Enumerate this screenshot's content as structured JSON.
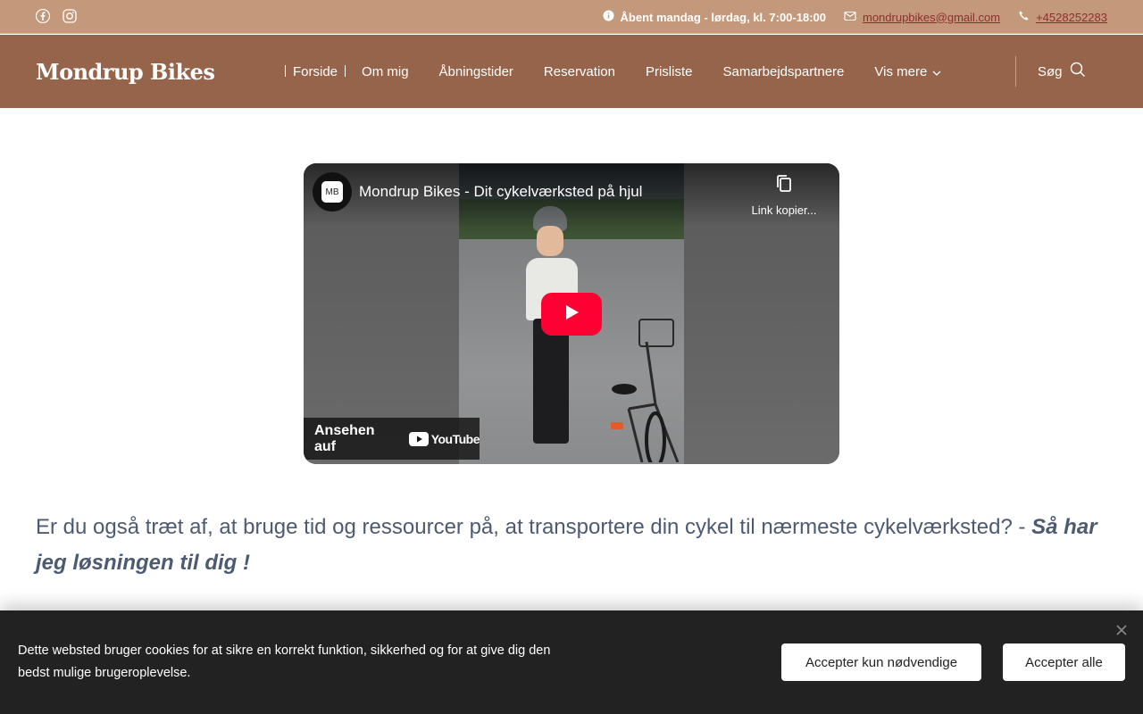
{
  "topbar": {
    "social": [
      "facebook-icon",
      "instagram-icon"
    ],
    "hours": "Åbent mandag - lørdag, kl. 7:00-18:00",
    "email": "mondrupbikes@gmail.com",
    "phone": "+4528252283"
  },
  "header": {
    "logo": "Mondrup Bikes",
    "nav": [
      "Forside",
      "Om mig",
      "Åbningstider",
      "Reservation",
      "Prisliste",
      "Samarbejdspartnere"
    ],
    "more_label": "Vis mere",
    "search_label": "Søg"
  },
  "video": {
    "channel_badge": "MB",
    "title": "Mondrup Bikes - Dit cykelværksted på hjul",
    "copy_label": "Link kopier...",
    "watch_label": "Ansehen auf",
    "youtube_label": "YouTube"
  },
  "main": {
    "lead_text": "Er du også træt af, at bruge tid og ressourcer på, at transportere din cykel til nærmeste cykelværksted? - ",
    "lead_strong": "Så har jeg løsningen til dig !"
  },
  "cookie": {
    "text": "Dette websted bruger cookies for at sikre en korrekt funktion, sikkerhed og for at give dig den bedst mulige brugeroplevelse.",
    "btn_necessary": "Accepter kun nødvendige",
    "btn_all": "Accepter alle"
  },
  "colors": {
    "topbar": "#c4997b",
    "header": "#95644a",
    "link": "#8c2f2f",
    "text": "#4c5b72",
    "cookie_bg": "#222222",
    "play": "#ff0033"
  }
}
